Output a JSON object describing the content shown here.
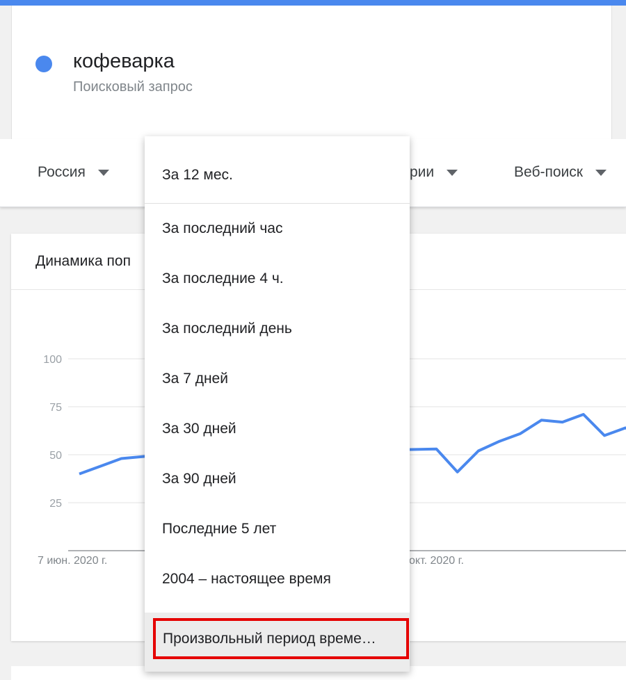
{
  "search_term": {
    "name": "кофеварка",
    "type": "Поисковый запрос",
    "color": "#4a88ee"
  },
  "filters": {
    "region": "Россия",
    "category_partial": "рии",
    "search_type": "Веб-поиск"
  },
  "chart_card": {
    "title_partial": "Динамика поп"
  },
  "dropdown": {
    "selected": "За 12 мес.",
    "options": [
      "За последний час",
      "За последние 4 ч.",
      "За последний день",
      "За 7 дней",
      "За 30 дней",
      "За 90 дней",
      "Последние 5 лет",
      "2004 – настоящее время"
    ],
    "custom_option": "Произвольный период време…",
    "highlight_color": "#e50000"
  },
  "chart_data": {
    "type": "line",
    "ylim": [
      0,
      100
    ],
    "yticks": [
      "100",
      "75",
      "50",
      "25"
    ],
    "xtick_labels": [
      "7 июн. 2020 г.",
      "окт. 2020 г."
    ],
    "series": [
      {
        "color": "#4a88ee",
        "points": [
          [
            0,
            40
          ],
          [
            1,
            44
          ],
          [
            2,
            48
          ],
          [
            3,
            49
          ],
          [
            4,
            50
          ],
          [
            17,
            53
          ],
          [
            18,
            41
          ],
          [
            19,
            52
          ],
          [
            20,
            57
          ],
          [
            21,
            61
          ],
          [
            22,
            68
          ],
          [
            23,
            67
          ],
          [
            24,
            71
          ],
          [
            25,
            60
          ],
          [
            26,
            64
          ],
          [
            27,
            59
          ],
          [
            28,
            56
          ]
        ]
      }
    ]
  }
}
